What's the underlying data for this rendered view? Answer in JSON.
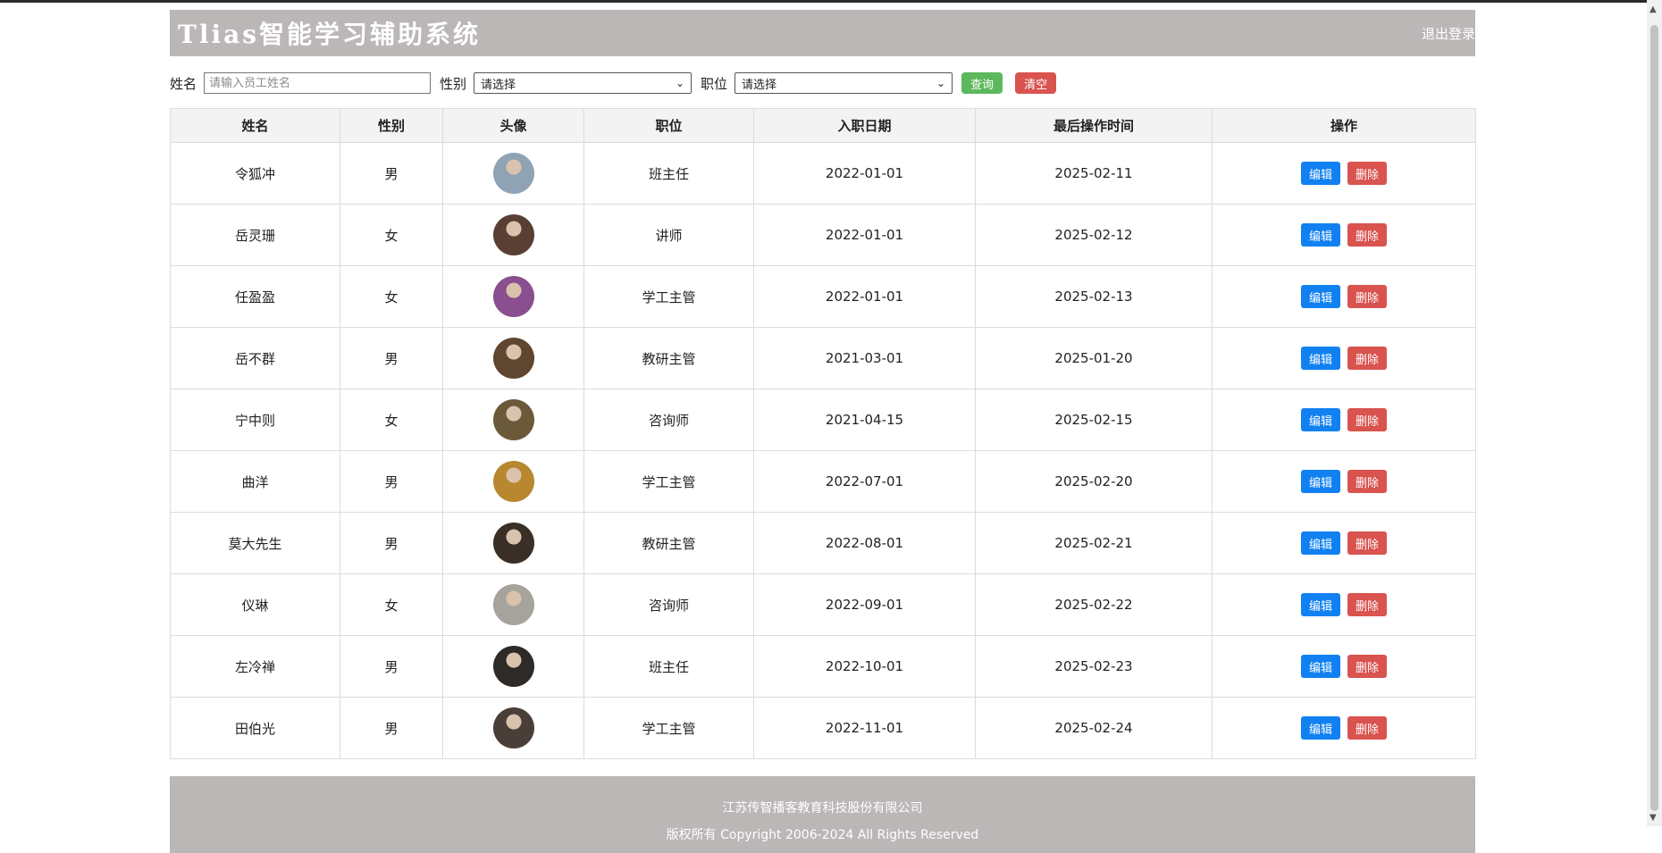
{
  "app": {
    "title": "Tlias智能学习辅助系统",
    "logout": "退出登录"
  },
  "search": {
    "name_label": "姓名",
    "name_placeholder": "请输入员工姓名",
    "gender_label": "性别",
    "gender_value": "请选择",
    "job_label": "职位",
    "job_value": "请选择",
    "query_button": "查询",
    "clear_button": "清空"
  },
  "table": {
    "headers": [
      "姓名",
      "性别",
      "头像",
      "职位",
      "入职日期",
      "最后操作时间",
      "操作"
    ],
    "edit_label": "编辑",
    "delete_label": "删除",
    "rows": [
      {
        "name": "令狐冲",
        "gender": "男",
        "job": "班主任",
        "entry_date": "2022-01-01",
        "update_time": "2025-02-11",
        "avatar_color": "#8fa3b5"
      },
      {
        "name": "岳灵珊",
        "gender": "女",
        "job": "讲师",
        "entry_date": "2022-01-01",
        "update_time": "2025-02-12",
        "avatar_color": "#5a3f35"
      },
      {
        "name": "任盈盈",
        "gender": "女",
        "job": "学工主管",
        "entry_date": "2022-01-01",
        "update_time": "2025-02-13",
        "avatar_color": "#8a4f8f"
      },
      {
        "name": "岳不群",
        "gender": "男",
        "job": "教研主管",
        "entry_date": "2021-03-01",
        "update_time": "2025-01-20",
        "avatar_color": "#5e4630"
      },
      {
        "name": "宁中则",
        "gender": "女",
        "job": "咨询师",
        "entry_date": "2021-04-15",
        "update_time": "2025-02-15",
        "avatar_color": "#6b5a3a"
      },
      {
        "name": "曲洋",
        "gender": "男",
        "job": "学工主管",
        "entry_date": "2022-07-01",
        "update_time": "2025-02-20",
        "avatar_color": "#b8872f"
      },
      {
        "name": "莫大先生",
        "gender": "男",
        "job": "教研主管",
        "entry_date": "2022-08-01",
        "update_time": "2025-02-21",
        "avatar_color": "#3a2f26"
      },
      {
        "name": "仪琳",
        "gender": "女",
        "job": "咨询师",
        "entry_date": "2022-09-01",
        "update_time": "2025-02-22",
        "avatar_color": "#a6a39c"
      },
      {
        "name": "左冷禅",
        "gender": "男",
        "job": "班主任",
        "entry_date": "2022-10-01",
        "update_time": "2025-02-23",
        "avatar_color": "#2e2a27"
      },
      {
        "name": "田伯光",
        "gender": "男",
        "job": "学工主管",
        "entry_date": "2022-11-01",
        "update_time": "2025-02-24",
        "avatar_color": "#4a3f38"
      }
    ]
  },
  "footer": {
    "company": "江苏传智播客教育科技股份有限公司",
    "copyright": "版权所有 Copyright 2006-2024 All Rights Reserved"
  }
}
